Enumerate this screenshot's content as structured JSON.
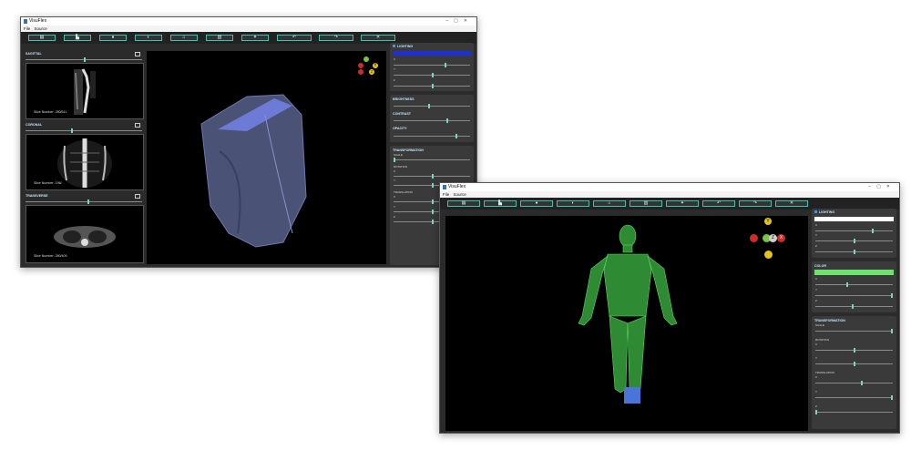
{
  "window1": {
    "title": "VisuFlex",
    "menu": [
      "File",
      "Source"
    ],
    "toolbar": [
      "▤",
      "▙",
      "●",
      "◐",
      "⌂",
      "▥",
      "✦",
      "↶",
      "↷",
      "✕"
    ],
    "slices": [
      {
        "label": "SAGITTAL",
        "slice_text": "Slice Number: 280/511"
      },
      {
        "label": "CORONAL",
        "slice_text": "Slice Number: 196/"
      },
      {
        "label": "TRANSVERSE",
        "slice_text": "Slice Number: 280/409"
      }
    ],
    "right_panel": {
      "lighting": "LIGHTING",
      "lighting_color": "#1e2fd6",
      "axes": [
        "X",
        "Y",
        "Z"
      ],
      "brightness": "BRIGHTNESS",
      "contrast": "CONTRAST",
      "opacity": "OPACITY",
      "transformation": "TRANSFORMATION",
      "scale": "SCALE",
      "rotation": "ROTATION",
      "translation": "TRANSLATION"
    },
    "gizmo": {
      "y": "Y",
      "z": "Z"
    }
  },
  "window2": {
    "title": "VisuFlex",
    "menu": [
      "File",
      "Source"
    ],
    "toolbar": [
      "▤",
      "▙",
      "●",
      "◐",
      "⌂",
      "▥",
      "✦",
      "↶",
      "↷",
      "✕"
    ],
    "right_panel": {
      "lighting": "LIGHTING",
      "lighting_color": "#ffffff",
      "color": "COLOR",
      "model_color": "#6ee26e",
      "axes": [
        "X",
        "Y",
        "Z"
      ],
      "transformation": "TRANSFORMATION",
      "scale": "SCALE",
      "rotation": "ROTATION",
      "translation": "TRANSLATION"
    },
    "gizmo": {
      "y": "Y",
      "z": "Z",
      "x": "X"
    }
  },
  "colors": {
    "accent": "#3fbfae",
    "panel": "#3a3a3a",
    "gizmo_red": "#d12a2a",
    "gizmo_yellow": "#e6c21b",
    "gizmo_green": "#7bc142"
  }
}
